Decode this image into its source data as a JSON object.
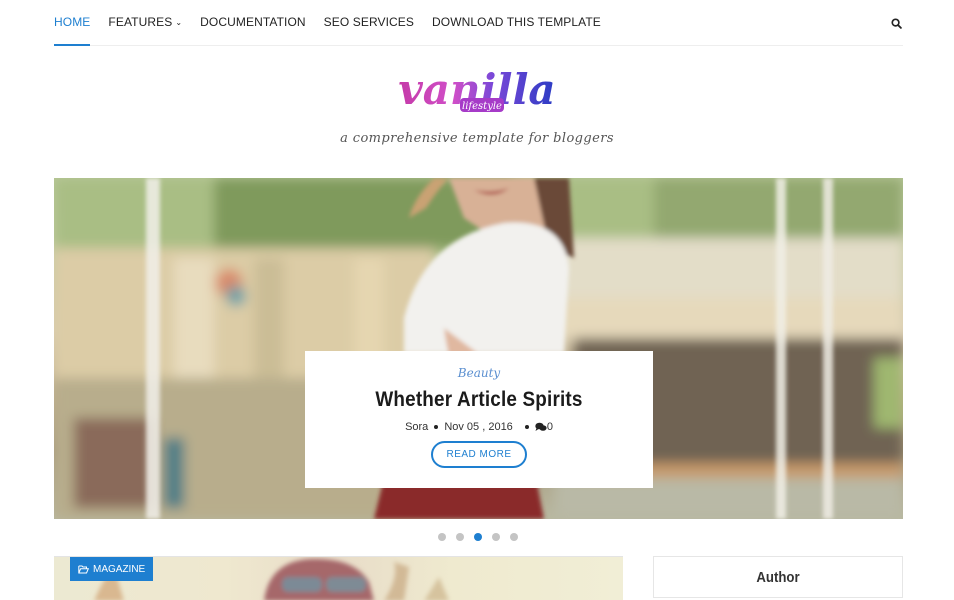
{
  "nav": {
    "items": [
      {
        "label": "HOME",
        "active": true
      },
      {
        "label": "FEATURES",
        "has_dropdown": true
      },
      {
        "label": "DOCUMENTATION"
      },
      {
        "label": "SEO SERVICES"
      },
      {
        "label": "DOWNLOAD THIS TEMPLATE"
      }
    ],
    "search_icon": "search-icon"
  },
  "logo": {
    "word": "vanilla",
    "sub": "lifestyle",
    "tagline": "a comprehensive template for bloggers"
  },
  "slider": {
    "category": "Beauty",
    "title": "Whether Article Spirits",
    "author": "Sora",
    "date": "Nov 05 , 2016",
    "comments": "0",
    "read_more": "READ MORE",
    "slide_count": 5,
    "active_slide": 3
  },
  "post": {
    "badge_label": "MAGAZINE",
    "badge_icon": "folder-open-icon"
  },
  "sidebar": {
    "author_title": "Author"
  },
  "colors": {
    "accent": "#1e7fd0",
    "text": "#222222"
  }
}
